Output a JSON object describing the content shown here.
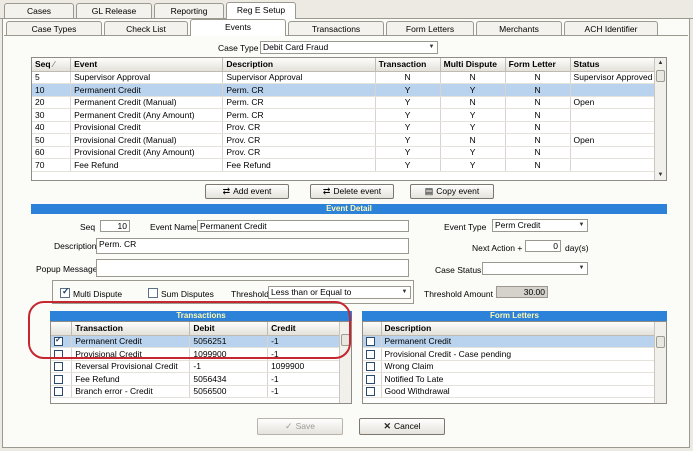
{
  "top_tabs": [
    "Cases",
    "GL Release",
    "Reporting",
    "Reg E Setup"
  ],
  "sub_tabs": [
    "Case Types",
    "Check List",
    "Events",
    "Transactions",
    "Form Letters",
    "Merchants",
    "ACH Identifier"
  ],
  "case_type": {
    "label": "Case Type",
    "value": "Debit Card Fraud"
  },
  "events_table": {
    "columns": [
      "Seq",
      "Event",
      "Description",
      "Transaction",
      "Multi Dispute",
      "Form Letter",
      "Status"
    ],
    "rows": [
      [
        "5",
        "Supervisor Approval",
        "Supervisor Approval",
        "N",
        "N",
        "N",
        "Supervisor Approved"
      ],
      [
        "10",
        "Permanent Credit",
        "Perm. CR",
        "Y",
        "Y",
        "N",
        ""
      ],
      [
        "20",
        "Permanent Credit (Manual)",
        "Perm. CR",
        "Y",
        "N",
        "N",
        "Open"
      ],
      [
        "30",
        "Permanent Credit (Any Amount)",
        "Perm. CR",
        "Y",
        "Y",
        "N",
        ""
      ],
      [
        "40",
        "Provisional Credit",
        "Prov. CR",
        "Y",
        "Y",
        "N",
        ""
      ],
      [
        "50",
        "Provisional Credit (Manual)",
        "Prov. CR",
        "Y",
        "N",
        "N",
        "Open"
      ],
      [
        "60",
        "Provisional Credit (Any Amount)",
        "Prov. CR",
        "Y",
        "Y",
        "N",
        ""
      ],
      [
        "70",
        "Fee Refund",
        "Fee Refund",
        "Y",
        "Y",
        "N",
        ""
      ]
    ]
  },
  "buttons": {
    "add_event": "Add event",
    "delete_event": "Delete event",
    "copy_event": "Copy event",
    "save": "Save",
    "cancel": "Cancel"
  },
  "event_detail": {
    "title": "Event Detail",
    "seq_label": "Seq",
    "seq_value": "10",
    "event_name_label": "Event Name",
    "event_name_value": "Permanent Credit",
    "description_label": "Description",
    "description_value": "Perm. CR",
    "popup_label": "Popup Message",
    "event_type_label": "Event Type",
    "event_type_value": "Perm Credit",
    "next_action_label": "Next Action +",
    "next_action_value": "0",
    "next_action_unit": "day(s)",
    "case_status_label": "Case Status",
    "case_status_value": "",
    "multi_dispute_label": "Multi Dispute",
    "sum_disputes_label": "Sum Disputes",
    "threshold_label": "Threshold",
    "threshold_value": "Less than or Equal to",
    "threshold_amount_label": "Threshold Amount",
    "threshold_amount_value": "30.00"
  },
  "transactions": {
    "title": "Transactions",
    "columns": [
      "Transaction",
      "Debit",
      "Credit"
    ],
    "rows": [
      [
        true,
        "Permanent Credit",
        "5056251",
        "-1"
      ],
      [
        false,
        "Provisional Credit",
        "1099900",
        "-1"
      ],
      [
        false,
        "Reversal Provisional Credit",
        "-1",
        "1099900"
      ],
      [
        false,
        "Fee Refund",
        "5056434",
        "-1"
      ],
      [
        false,
        "Branch error - Credit",
        "5056500",
        "-1"
      ]
    ]
  },
  "form_letters": {
    "title": "Form Letters",
    "columns": [
      "Description"
    ],
    "rows": [
      "Permanent Credit",
      "Provisional Credit - Case pending",
      "Wrong Claim",
      "Notified To Late",
      "Good Withdrawal"
    ]
  },
  "colors": {
    "accent": "#2b82d8",
    "selection": "#b9d3ee",
    "highlight_oval": "#c5262f"
  }
}
